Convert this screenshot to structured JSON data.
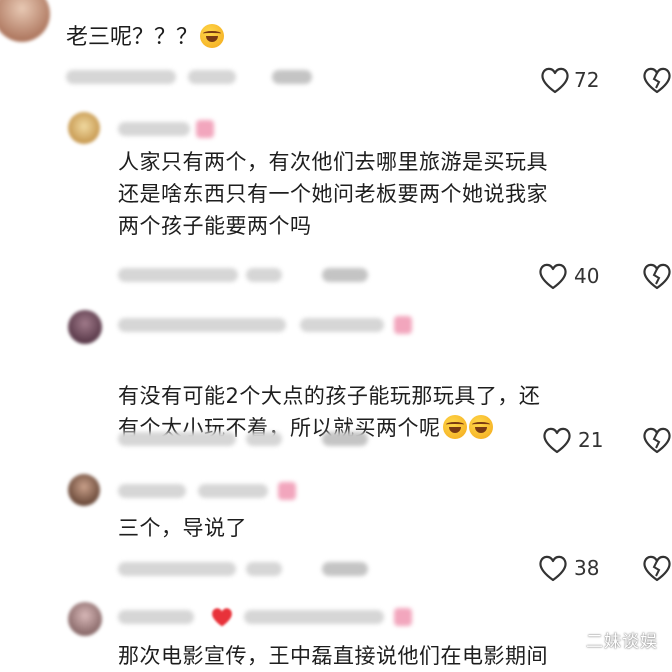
{
  "comments": [
    {
      "text": "老三呢？？？",
      "emoji_icons": [
        "laughing-emoji-icon"
      ],
      "likes": "72"
    },
    {
      "text": "人家只有两个，有次他们去哪里旅游是买玩具\n还是啥东西只有一个她问老板要两个她说我家\n两个孩子能要两个吗",
      "emoji_icons": [],
      "likes": "40"
    },
    {
      "text": "有没有可能2个大点的孩子能玩那玩具了，还\n有个太小玩不着，所以就买两个呢",
      "emoji_icons": [
        "rofl-emoji-icon",
        "rofl-emoji-icon"
      ],
      "likes": "21"
    },
    {
      "text": "三个，导说了",
      "emoji_icons": [],
      "likes": "38"
    },
    {
      "text": "那次电影宣传，王中磊直接说他们在电影期间",
      "emoji_icons": [],
      "likes": ""
    }
  ],
  "watermark": "二妹谈娱",
  "colors": {
    "heart_stroke": "#333333",
    "blur_gray": "#d6d6d6",
    "badge_pink": "#f2a6bd"
  }
}
